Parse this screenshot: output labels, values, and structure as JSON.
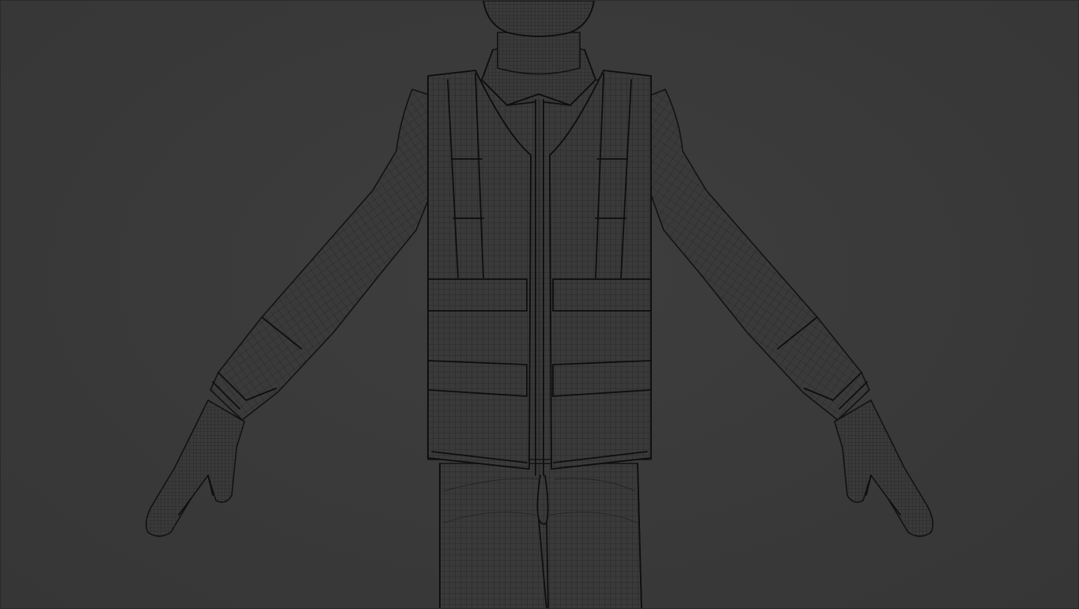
{
  "viewport": {
    "mode": "wireframe",
    "background": "#3a3a3a",
    "wire_color": "#1a1a1a"
  },
  "model": {
    "subject": "character",
    "pose": "A-pose"
  }
}
